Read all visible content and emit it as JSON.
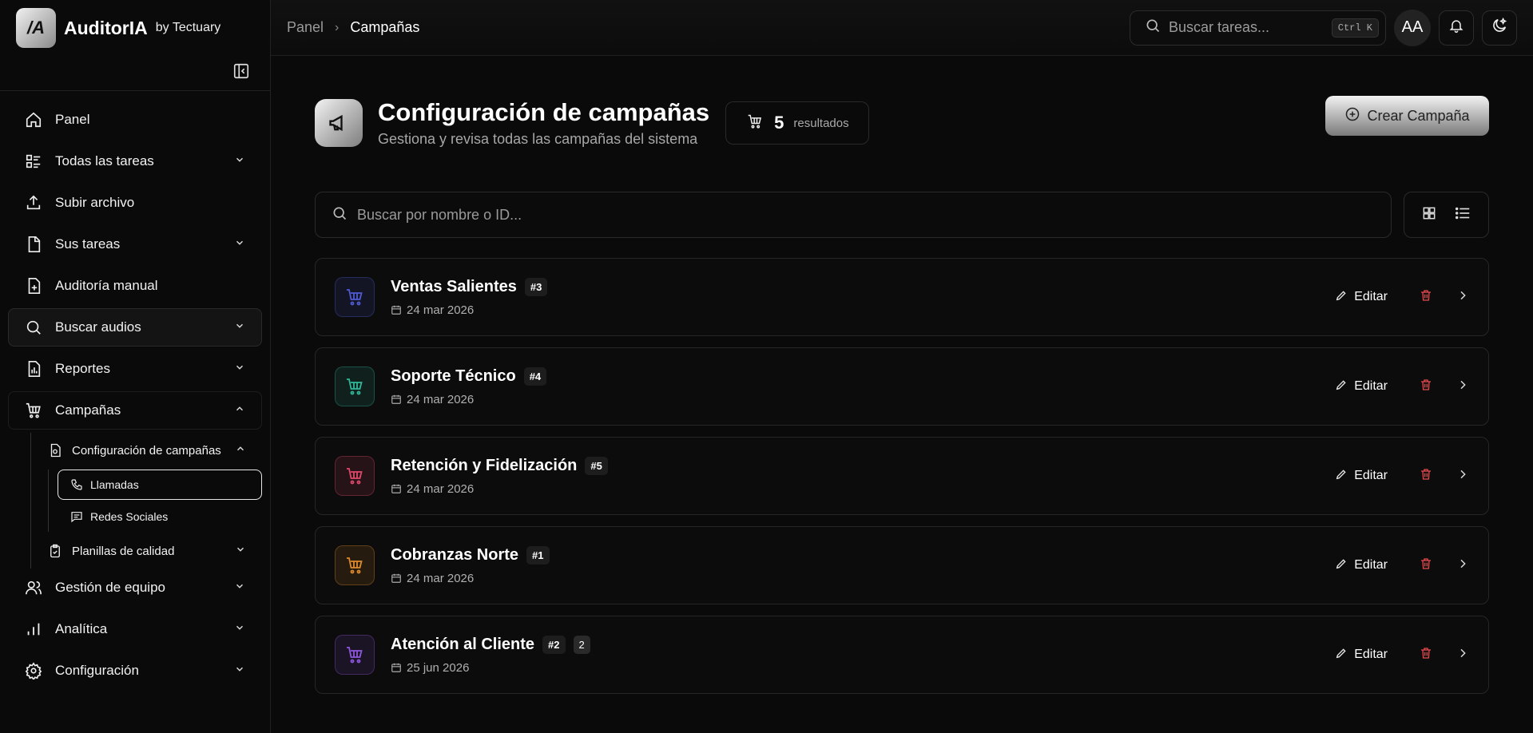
{
  "app": {
    "logo_text": "/A",
    "name": "AuditorIA",
    "by": "by Tectuary"
  },
  "topbar": {
    "breadcrumb": [
      "Panel",
      "Campañas"
    ],
    "search_placeholder": "Buscar tareas...",
    "shortcut": "Ctrl K",
    "avatar": "AA"
  },
  "sidebar": {
    "items": [
      {
        "label": "Panel",
        "icon": "home-icon"
      },
      {
        "label": "Todas las tareas",
        "icon": "list-icon"
      },
      {
        "label": "Subir archivo",
        "icon": "upload-icon"
      },
      {
        "label": "Sus tareas",
        "icon": "file-icon"
      },
      {
        "label": "Auditoría manual",
        "icon": "file-plus-icon"
      },
      {
        "label": "Buscar audios",
        "icon": "search-icon"
      },
      {
        "label": "Reportes",
        "icon": "report-icon"
      },
      {
        "label": "Campañas",
        "icon": "cart-icon"
      }
    ],
    "campaign_sub": {
      "label": "Configuración de campañas",
      "children": [
        "Llamadas",
        "Redes Sociales"
      ]
    },
    "quality": "Planillas de calidad",
    "bottom_items": [
      {
        "label": "Gestión de equipo",
        "icon": "users-icon"
      },
      {
        "label": "Analítica",
        "icon": "chart-icon"
      },
      {
        "label": "Configuración",
        "icon": "gear-icon"
      }
    ]
  },
  "page": {
    "title": "Configuración de campañas",
    "subtitle": "Gestiona y revisa todas las campañas del sistema",
    "count": "5",
    "count_label": "resultados",
    "create_label": "Crear Campaña",
    "filter_placeholder": "Buscar por nombre o ID..."
  },
  "campaigns": [
    {
      "name": "Ventas Salientes",
      "id": "#3",
      "extra": "",
      "date": "24 mar 2026",
      "color": "#4f5bd5"
    },
    {
      "name": "Soporte Técnico",
      "id": "#4",
      "extra": "",
      "date": "24 mar 2026",
      "color": "#2fb89a"
    },
    {
      "name": "Retención y Fidelización",
      "id": "#5",
      "extra": "",
      "date": "24 mar 2026",
      "color": "#e0476a"
    },
    {
      "name": "Cobranzas Norte",
      "id": "#1",
      "extra": "",
      "date": "24 mar 2026",
      "color": "#e08a2a"
    },
    {
      "name": "Atención al Cliente",
      "id": "#2",
      "extra": "2",
      "date": "25 jun 2026",
      "color": "#8f55e0"
    }
  ],
  "actions": {
    "edit": "Editar"
  }
}
